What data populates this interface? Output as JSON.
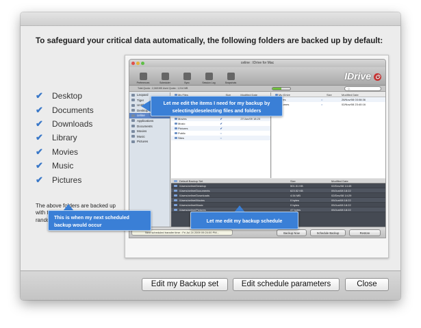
{
  "dialog": {
    "headline": "To safeguard your critical data automatically, the following folders are backed up by default:",
    "folders": [
      "Desktop",
      "Documents",
      "Downloads",
      "Library",
      "Movies",
      "Music",
      "Pictures"
    ],
    "note": "The above folders are backed up with the scheduled time set to a random 'off-peak hour'.",
    "buttons": {
      "edit_backup_set": "Edit my Backup set",
      "edit_schedule": "Edit schedule parameters",
      "close": "Close"
    }
  },
  "app": {
    "title": "celine : IDrive for Mac",
    "logo": "IDrive",
    "toolbar": [
      "Preferences",
      "Scheduler",
      "Sync",
      "Session Log",
      "Snapshots"
    ],
    "quota": "Total Quota : 2,048 MB     Used Quota : 1,014 MB",
    "progress": 0.5,
    "search_placeholder": "Q-",
    "sidebar": {
      "items": [
        "Leopard",
        "Tiger",
        "Untitled",
        "Desktop",
        "celine",
        "Applications",
        "Documents",
        "Movies",
        "Music",
        "Pictures"
      ],
      "selected": "celine",
      "quota_label": "49%"
    },
    "left_pane": {
      "headers": [
        "My Files",
        "",
        "Size",
        "Modified Date"
      ],
      "rows": [
        [
          "Desktop",
          "✔",
          "",
          "24/Jul/09 15:42"
        ],
        [
          "Documents",
          "✔",
          "",
          "11/Jun/09 15:35"
        ],
        [
          "Downloads",
          "✔",
          "",
          "14/May/09 15:49"
        ],
        [
          "Library",
          "✔",
          "",
          "17/Nov/08 18:33"
        ],
        [
          "Movies",
          "✔",
          "",
          "27/Jun/09 18:23"
        ],
        [
          "Music",
          "✔",
          "",
          ""
        ],
        [
          "Pictures",
          "✔",
          "",
          ""
        ],
        [
          "Public",
          "○",
          "",
          ""
        ],
        [
          "Sites",
          "○",
          "",
          ""
        ]
      ]
    },
    "right_pane": {
      "headers": [
        "My IDrive",
        "",
        "Size",
        "Modified Date"
      ],
      "rows": [
        [
          "Users",
          "○",
          "",
          "28/Nov/08 03:08:36"
        ],
        [
          "Volumes",
          "○",
          "",
          "02/Nov/08 23:40:16"
        ]
      ]
    },
    "backup_set": {
      "headers": [
        "Default Backup Set",
        "Size",
        "Modified Date"
      ],
      "rows": [
        [
          "/Users/celine/Desktop",
          "501.51 KB",
          "02/Dec/08 14:45"
        ],
        [
          "/Users/celine/Documents",
          "623.52 KB",
          "09/Jun/08 18:22"
        ],
        [
          "/Users/celine/Downloads",
          "4.54 MB",
          "02/Dec/08 14:29"
        ],
        [
          "/Users/celine/Movies",
          "0 bytes",
          "09/Jun/08 18:22"
        ],
        [
          "/Users/celine/Music",
          "0 bytes",
          "09/Jun/08 18:22"
        ],
        [
          "/Users/celine/Pictures",
          "47 bytes",
          "09/Jun/08 18:22"
        ]
      ]
    },
    "next_schedule": "Next scheduled transfer time : Fri Jul 24 2009 09:24:00 PM...",
    "actions": {
      "backup_now": "Backup Now",
      "schedule_backup": "Schedule Backup",
      "restore": "Restore"
    }
  },
  "callouts": {
    "edit_items": "Let me edit the items I need for my backup by selecting/deselecting files and folders",
    "next_backup": "This is when my next scheduled backup would occur",
    "edit_schedule": "Let me edit my backup schedule"
  },
  "colors": {
    "callout": "#3a7fd6",
    "check": "#3a78c8",
    "selection": "#5e86c8"
  }
}
